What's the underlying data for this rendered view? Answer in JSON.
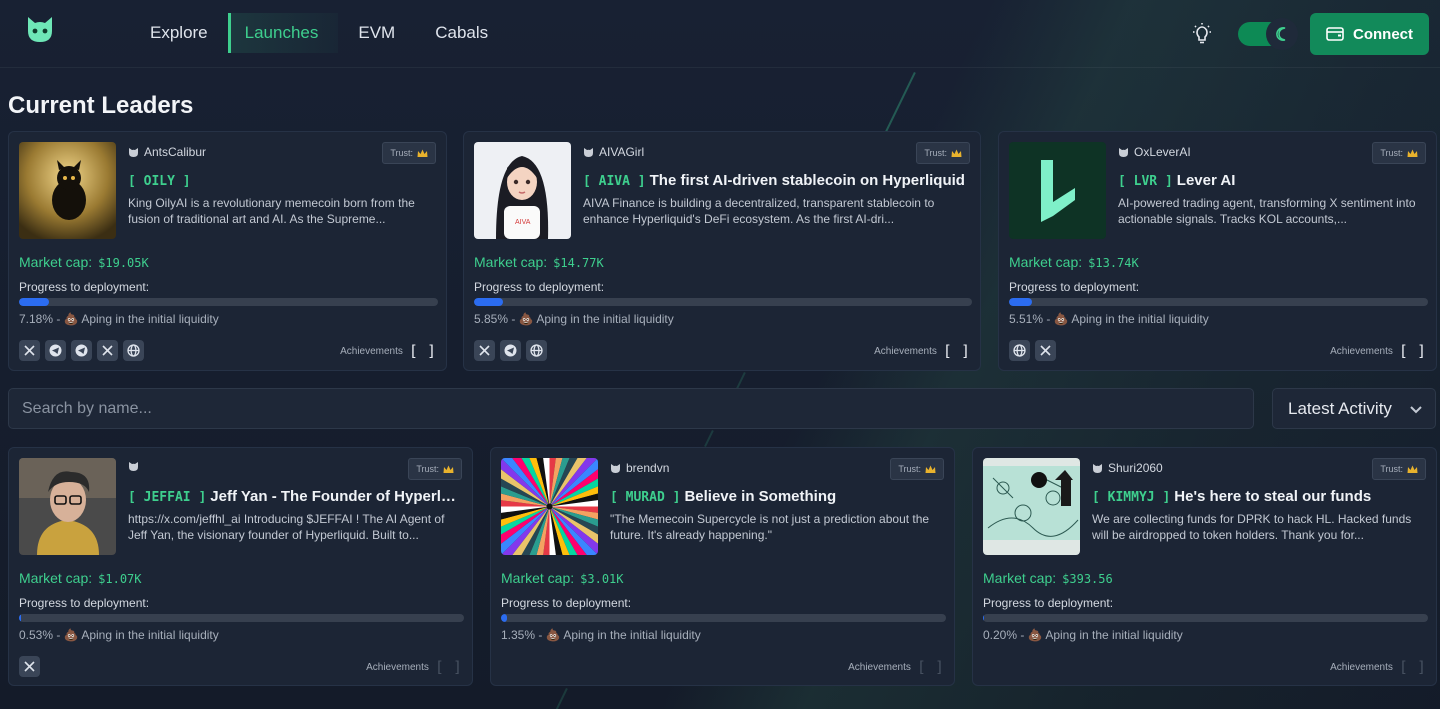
{
  "nav": {
    "items": [
      {
        "label": "Explore",
        "active": false
      },
      {
        "label": "Launches",
        "active": true
      },
      {
        "label": "EVM",
        "active": false
      },
      {
        "label": "Cabals",
        "active": false
      }
    ]
  },
  "header": {
    "connect_label": "Connect"
  },
  "colors": {
    "accent": "#3ecf8e",
    "connect_bg": "#128a5a",
    "progress": "#2b6cf0",
    "card_bg": "#1c2535"
  },
  "section_title": "Current Leaders",
  "search": {
    "placeholder": "Search by name..."
  },
  "sort": {
    "selected": "Latest Activity"
  },
  "common": {
    "market_cap_label": "Market cap:",
    "progress_label": "Progress to deployment:",
    "stage": "Aping in the initial liquidity",
    "trust_label": "Trust:",
    "achievements_label": "Achievements",
    "achievements_value": "[ ]"
  },
  "leaders": [
    {
      "creator": "AntsCalibur",
      "ticker": "[ OILY ]",
      "title": "",
      "desc": "King OilyAI is a revolutionary memecoin born from the fusion of traditional art and AI. As the Supreme...",
      "market_cap": "$19.05K",
      "progress_pct": 7.18,
      "progress_text": "7.18%",
      "socials": [
        "x-icon",
        "telegram-icon",
        "telegram-icon",
        "x-icon",
        "globe-icon"
      ]
    },
    {
      "creator": "AIVAGirl",
      "ticker": "[ AIVA ]",
      "title": "The first AI-driven stablecoin on Hyperliquid",
      "desc": "AIVA Finance is building a decentralized, transparent stablecoin to enhance Hyperliquid's DeFi ecosystem. As the first AI-dri...",
      "market_cap": "$14.77K",
      "progress_pct": 5.85,
      "progress_text": "5.85%",
      "socials": [
        "x-icon",
        "telegram-icon",
        "globe-icon"
      ]
    },
    {
      "creator": "OxLeverAI",
      "ticker": "[ LVR ]",
      "title": "Lever AI",
      "desc": "AI-powered trading agent, transforming X sentiment into actionable signals. Tracks KOL accounts,...",
      "market_cap": "$13.74K",
      "progress_pct": 5.51,
      "progress_text": "5.51%",
      "socials": [
        "globe-icon",
        "x-icon"
      ]
    }
  ],
  "launches": [
    {
      "creator": "",
      "ticker": "[ JEFFAI ]",
      "title": "Jeff Yan - The Founder of Hyperliquid",
      "desc": "https://x.com/jeffhl_ai Introducing $JEFFAI ! The AI Agent of Jeff Yan, the visionary founder of Hyperliquid. Built to...",
      "market_cap": "$1.07K",
      "progress_pct": 0.53,
      "progress_text": "0.53%",
      "socials": [
        "x-icon"
      ]
    },
    {
      "creator": "brendvn",
      "ticker": "[ MURAD ]",
      "title": "Believe in Something",
      "desc": "\"The Memecoin Supercycle is not just a prediction about the future. It's already happening.\"",
      "market_cap": "$3.01K",
      "progress_pct": 1.35,
      "progress_text": "1.35%",
      "socials": []
    },
    {
      "creator": "Shuri2060",
      "ticker": "[ KIMMYJ ]",
      "title": "He's here to steal our funds",
      "desc": "We are collecting funds for DPRK to hack HL. Hacked funds will be airdropped to token holders. Thank you for...",
      "market_cap": "$393.56",
      "progress_pct": 0.2,
      "progress_text": "0.20%",
      "socials": []
    }
  ]
}
